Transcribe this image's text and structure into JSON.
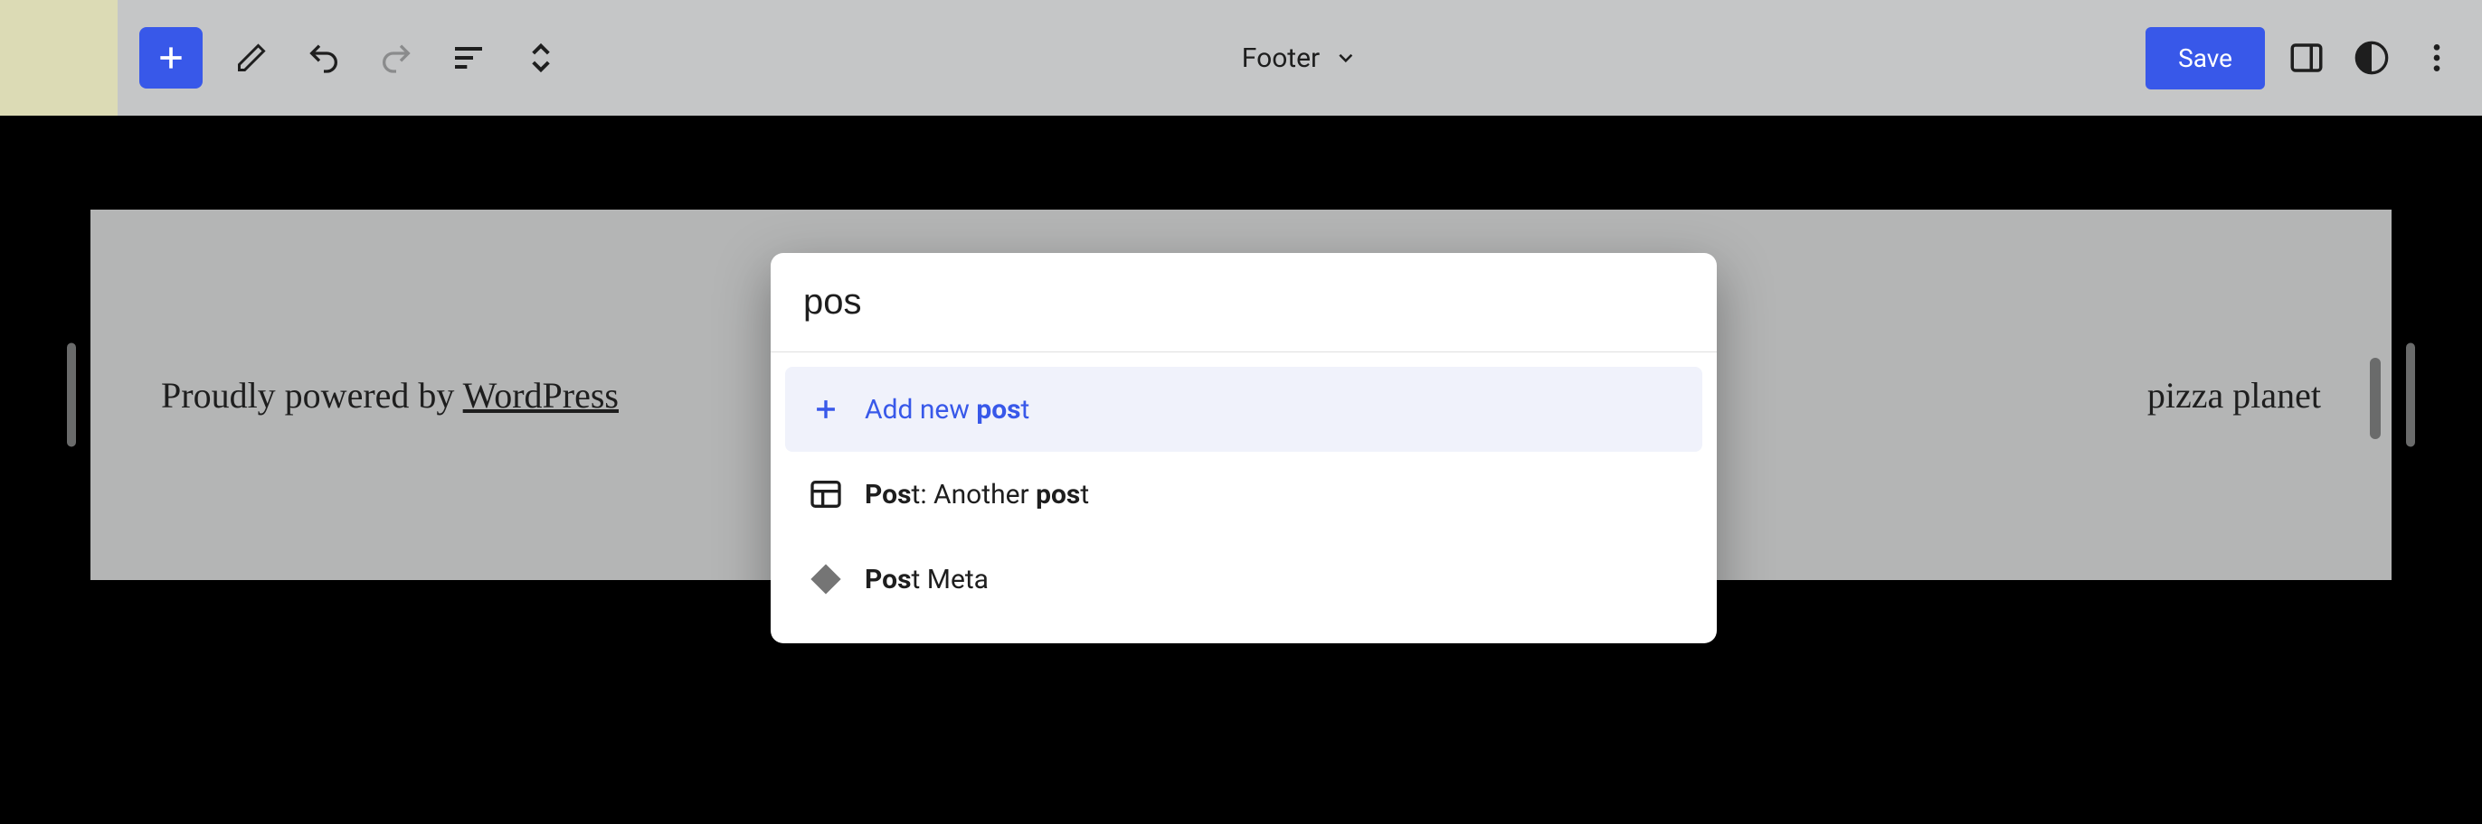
{
  "toolbar": {
    "title": "Footer",
    "save_label": "Save"
  },
  "footer": {
    "powered_prefix": "Proudly powered by ",
    "powered_link": "WordPress",
    "site_title": "pizza planet"
  },
  "popover": {
    "input_value": "pos",
    "items": [
      {
        "type": "add",
        "prefix": "Add new ",
        "match": "pos",
        "suffix": "t"
      },
      {
        "type": "template",
        "before": "Pos",
        "mid": "t: Another ",
        "match": "pos",
        "after": "t"
      },
      {
        "type": "meta",
        "before": "Pos",
        "after": "t Meta"
      }
    ]
  }
}
